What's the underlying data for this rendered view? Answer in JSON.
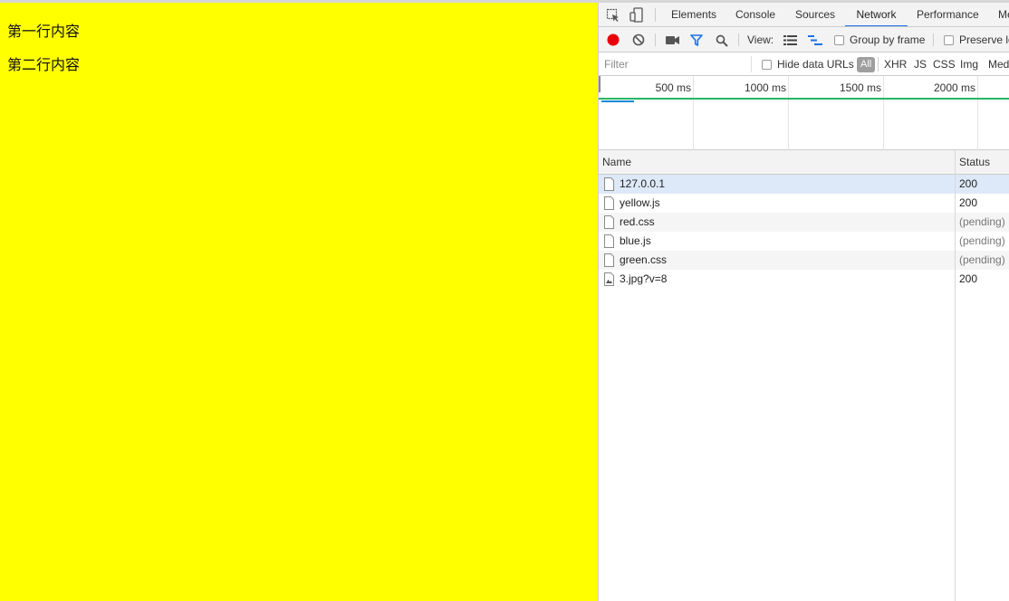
{
  "page": {
    "background": "#ffff00",
    "lines": [
      "第一行内容",
      "第二行内容"
    ]
  },
  "devtools": {
    "tabs": [
      "Elements",
      "Console",
      "Sources",
      "Network",
      "Performance",
      "Me"
    ],
    "active_tab": "Network",
    "toolbar": {
      "view_label": "View:",
      "group_by_frame": "Group by frame",
      "preserve_log": "Preserve lo"
    },
    "filter": {
      "placeholder": "Filter",
      "hide_data_urls": "Hide data URLs",
      "types": [
        "All",
        "XHR",
        "JS",
        "CSS",
        "Img",
        "Med"
      ]
    },
    "overview": {
      "ticks": [
        "500 ms",
        "1000 ms",
        "1500 ms",
        "2000 ms"
      ]
    },
    "table": {
      "headers": {
        "name": "Name",
        "status": "Status"
      },
      "rows": [
        {
          "name": "127.0.0.1",
          "status": "200",
          "icon": "document-icon"
        },
        {
          "name": "yellow.js",
          "status": "200",
          "icon": "document-icon"
        },
        {
          "name": "red.css",
          "status": "(pending)",
          "icon": "document-icon"
        },
        {
          "name": "blue.js",
          "status": "(pending)",
          "icon": "document-icon"
        },
        {
          "name": "green.css",
          "status": "(pending)",
          "icon": "document-icon"
        },
        {
          "name": "3.jpg?v=8",
          "status": "200",
          "icon": "image-file-icon"
        }
      ]
    },
    "colors": {
      "record": "#e8000b",
      "accent": "#1a73e8",
      "filter_active": "#1a73e8",
      "timeline_green": "#27b468",
      "timeline_blue": "#0a8bd1"
    }
  }
}
